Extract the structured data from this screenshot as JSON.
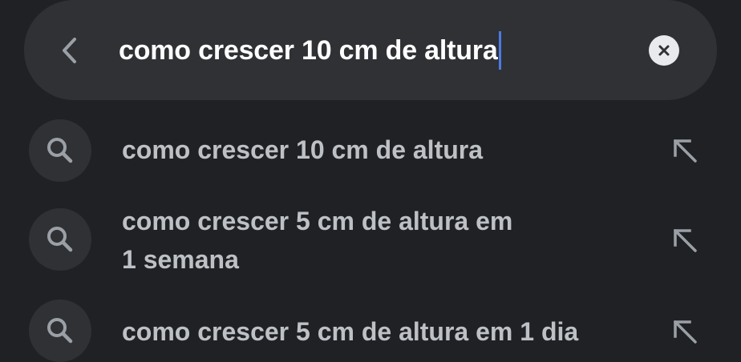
{
  "search": {
    "query": "como crescer 10 cm de altura"
  },
  "icons": {
    "back": "chevron-left-icon",
    "clear": "clear-x-icon",
    "suggestion": "search-icon",
    "fill_query": "arrow-up-left-icon"
  },
  "colors": {
    "background": "#202124",
    "search_bar": "#303134",
    "query_text": "#ffffff",
    "suggestion_text": "#bdc1c6",
    "caret": "#4c7ae6",
    "icon": "#9aa0a6"
  },
  "suggestions": [
    {
      "line1": "como crescer 10 cm de altura",
      "line2": ""
    },
    {
      "line1": "como crescer 5 cm de altura em",
      "line2": "1 semana"
    },
    {
      "line1": "como crescer 5 cm de altura em 1 dia",
      "line2": ""
    }
  ]
}
